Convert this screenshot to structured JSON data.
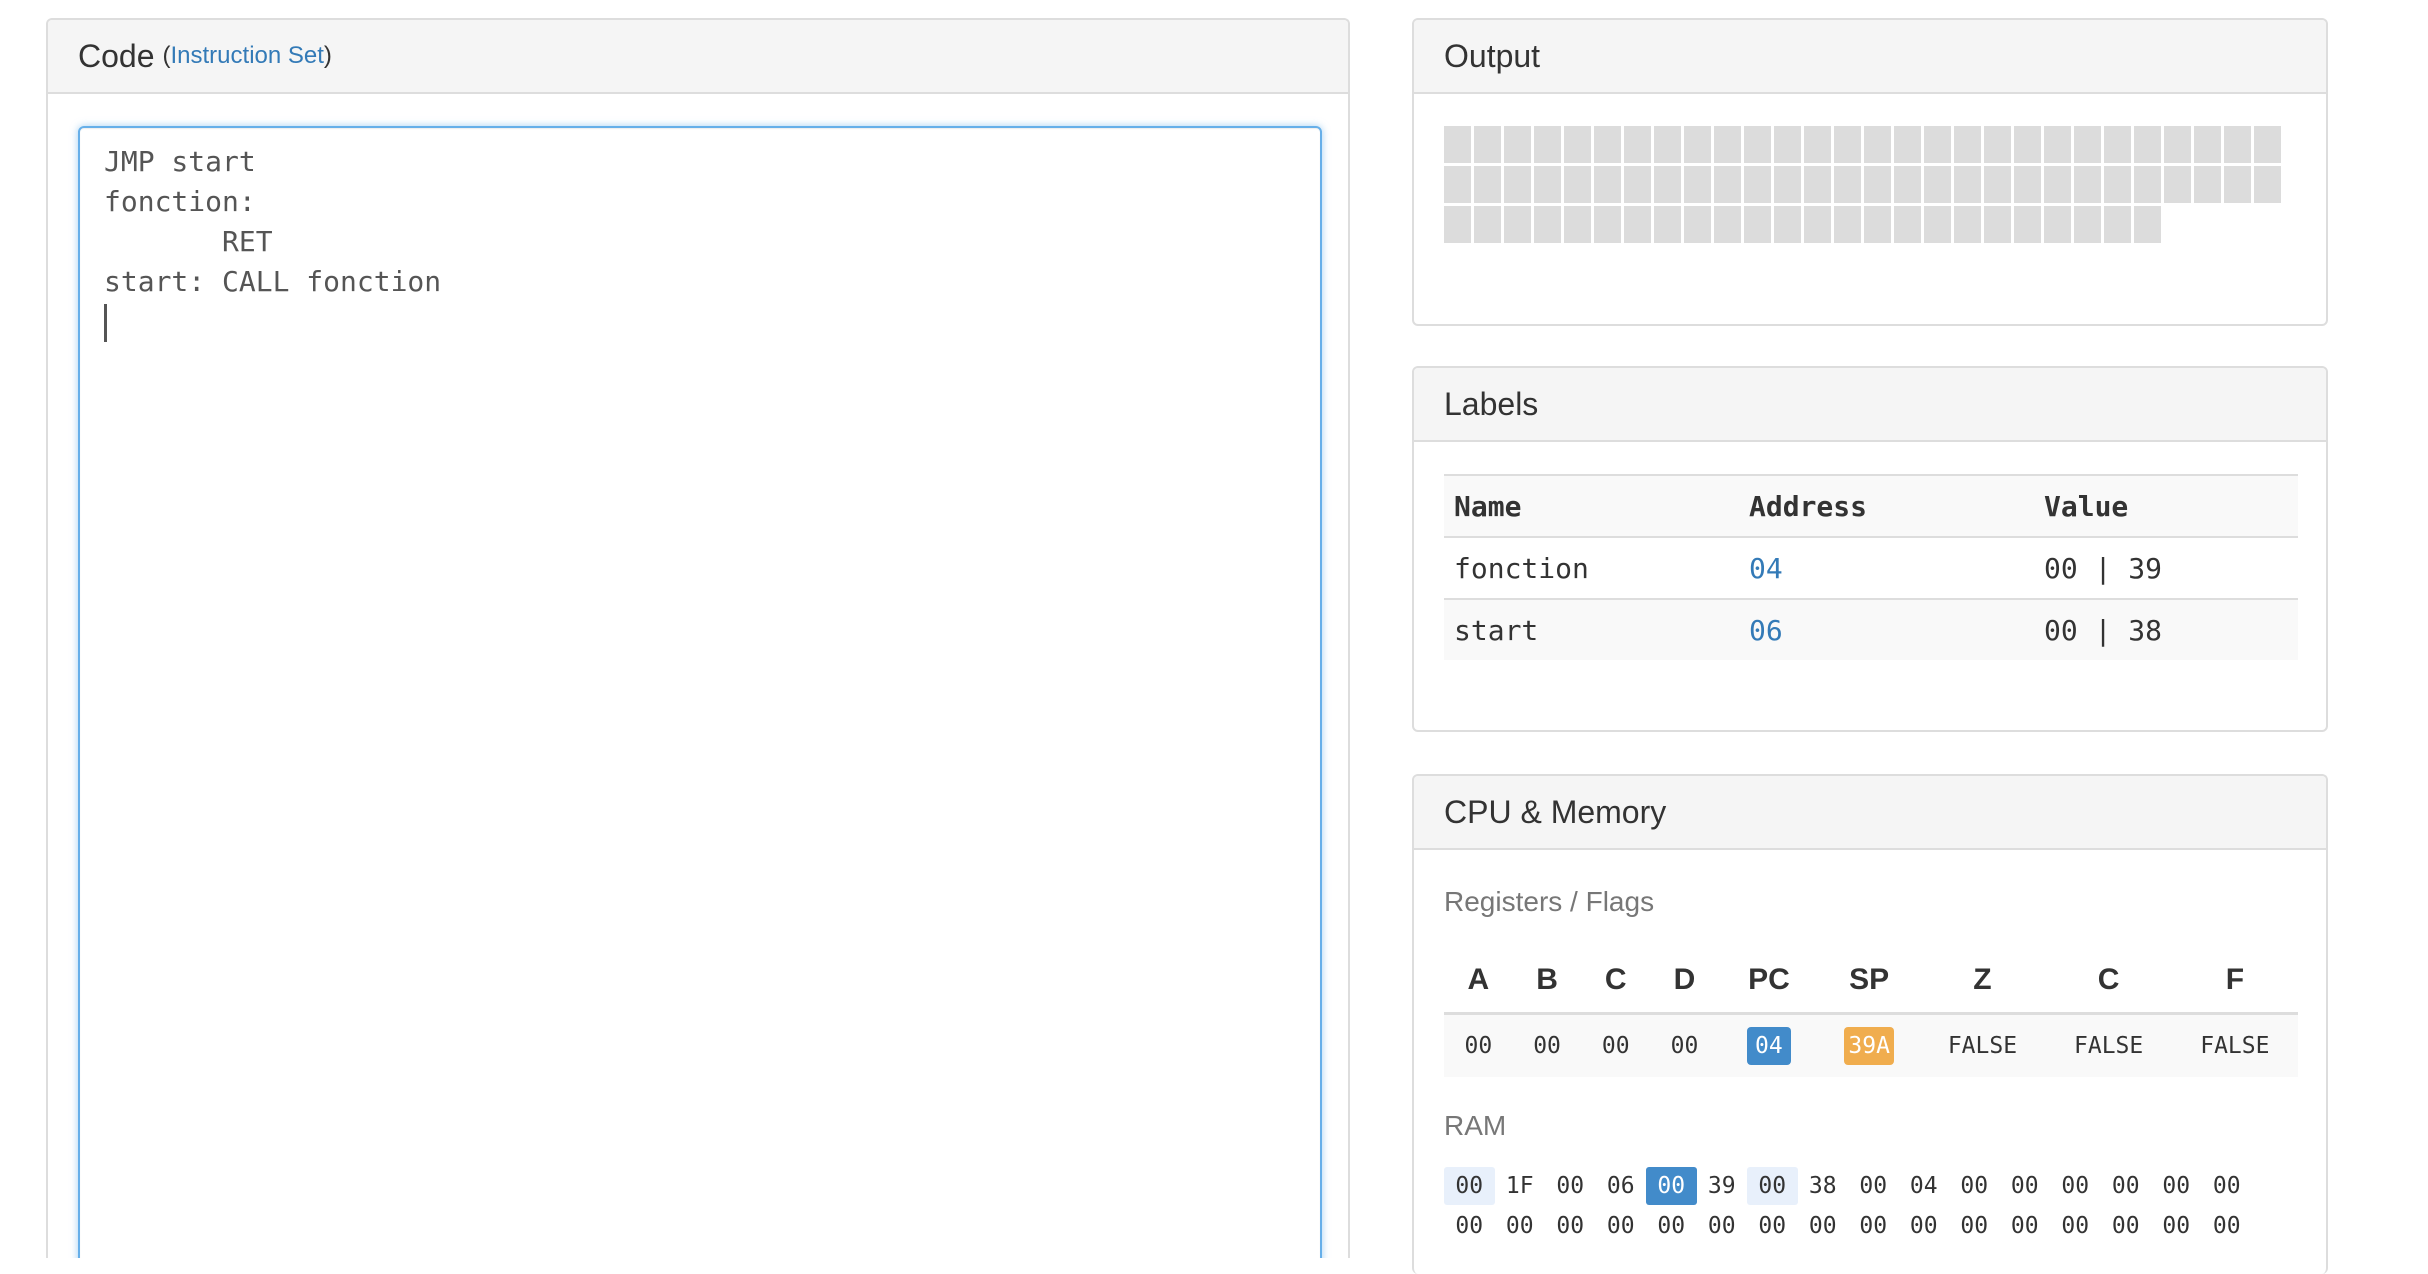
{
  "code_panel": {
    "title": "Code",
    "instruction_link": "Instruction Set",
    "code": "JMP start\nfonction:\n       RET\nstart: CALL fonction\n"
  },
  "output_panel": {
    "title": "Output",
    "cells": 80
  },
  "labels_panel": {
    "title": "Labels",
    "headers": [
      "Name",
      "Address",
      "Value"
    ],
    "rows": [
      {
        "name": "fonction",
        "address": "04",
        "value": "00 | 39"
      },
      {
        "name": "start",
        "address": "06",
        "value": "00 | 38"
      }
    ]
  },
  "cpu_panel": {
    "title": "CPU & Memory",
    "registers_title": "Registers / Flags",
    "registers": [
      {
        "name": "A",
        "value": "00"
      },
      {
        "name": "B",
        "value": "00"
      },
      {
        "name": "C",
        "value": "00"
      },
      {
        "name": "D",
        "value": "00"
      },
      {
        "name": "PC",
        "value": "04",
        "style": "pc"
      },
      {
        "name": "SP",
        "value": "39A",
        "style": "sp"
      },
      {
        "name": "Z",
        "value": "FALSE"
      },
      {
        "name": "C",
        "value": "FALSE"
      },
      {
        "name": "F",
        "value": "FALSE"
      }
    ],
    "ram_title": "RAM",
    "ram_rows": [
      [
        {
          "v": "00",
          "style": "light"
        },
        {
          "v": "1F"
        },
        {
          "v": "00"
        },
        {
          "v": "06"
        },
        {
          "v": "00",
          "style": "pc"
        },
        {
          "v": "39"
        },
        {
          "v": "00",
          "style": "light"
        },
        {
          "v": "38"
        },
        {
          "v": "00"
        },
        {
          "v": "04"
        },
        {
          "v": "00"
        },
        {
          "v": "00"
        },
        {
          "v": "00"
        },
        {
          "v": "00"
        },
        {
          "v": "00"
        },
        {
          "v": "00"
        }
      ],
      [
        {
          "v": "00"
        },
        {
          "v": "00"
        },
        {
          "v": "00"
        },
        {
          "v": "00"
        },
        {
          "v": "00"
        },
        {
          "v": "00"
        },
        {
          "v": "00"
        },
        {
          "v": "00"
        },
        {
          "v": "00"
        },
        {
          "v": "00"
        },
        {
          "v": "00"
        },
        {
          "v": "00"
        },
        {
          "v": "00"
        },
        {
          "v": "00"
        },
        {
          "v": "00"
        },
        {
          "v": "00"
        }
      ]
    ]
  }
}
